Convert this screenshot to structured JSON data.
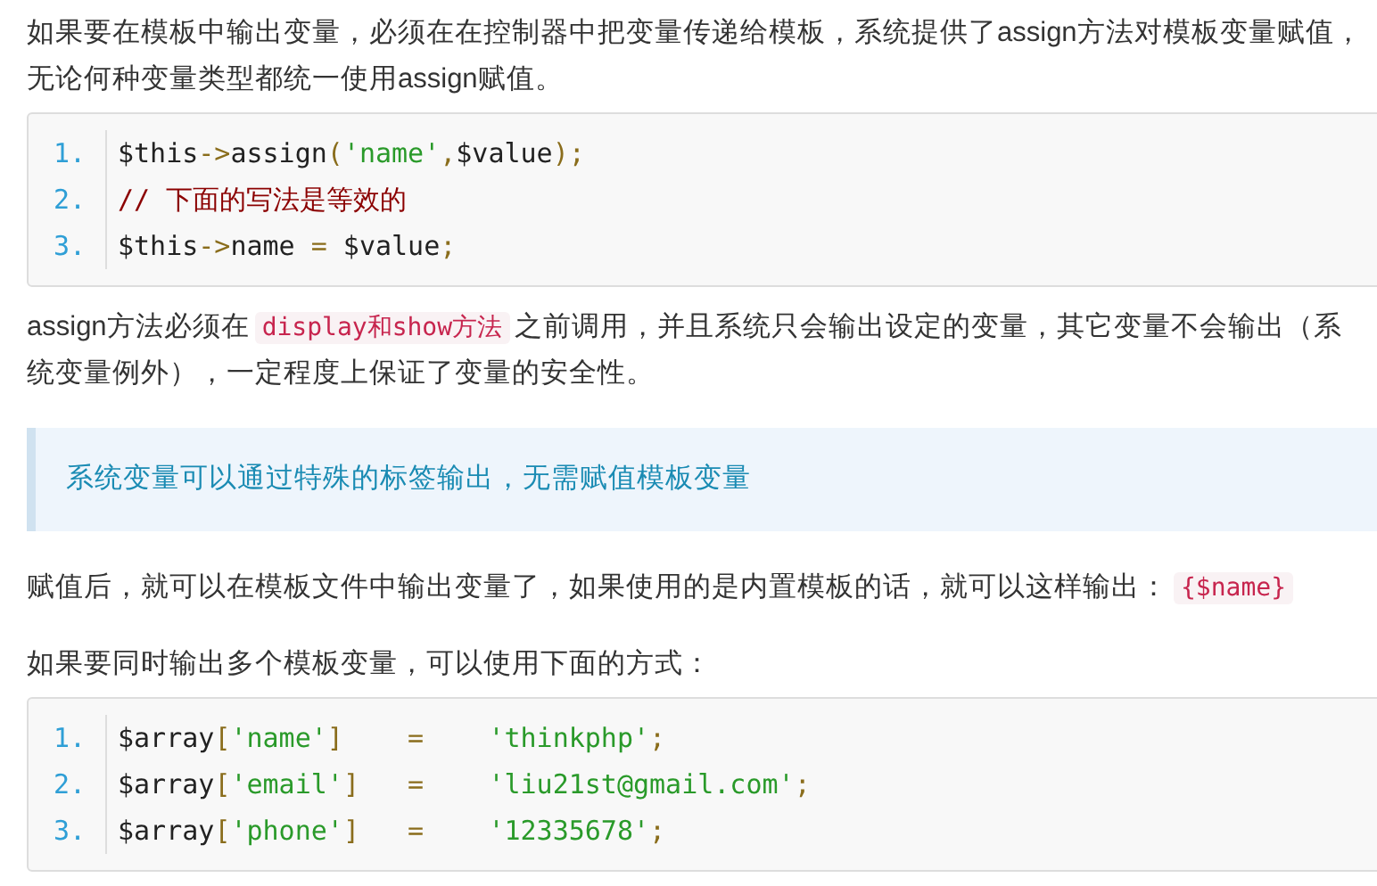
{
  "blocks": [
    {
      "kind": "paragraph",
      "parts": [
        {
          "kind": "text",
          "text": "如果要在模板中输出变量，必须在在控制器中把变量传递给模板，系统提供了assign方法对模板变量赋值，无论何种变量类型都统一使用assign赋值。"
        }
      ]
    },
    {
      "kind": "code",
      "lines": [
        {
          "number": "1.",
          "tokens": [
            {
              "kind": "plain",
              "text": "$this"
            },
            {
              "kind": "punct",
              "text": "->"
            },
            {
              "kind": "plain",
              "text": "assign"
            },
            {
              "kind": "punct",
              "text": "("
            },
            {
              "kind": "string",
              "text": "'name'"
            },
            {
              "kind": "punct",
              "text": ","
            },
            {
              "kind": "plain",
              "text": "$value"
            },
            {
              "kind": "punct",
              "text": ");"
            }
          ]
        },
        {
          "number": "2.",
          "tokens": [
            {
              "kind": "comment",
              "text": "// 下面的写法是等效的"
            }
          ]
        },
        {
          "number": "3.",
          "tokens": [
            {
              "kind": "plain",
              "text": "$this"
            },
            {
              "kind": "punct",
              "text": "->"
            },
            {
              "kind": "plain",
              "text": "name "
            },
            {
              "kind": "punct",
              "text": "="
            },
            {
              "kind": "plain",
              "text": " $value"
            },
            {
              "kind": "punct",
              "text": ";"
            }
          ]
        }
      ]
    },
    {
      "kind": "paragraph",
      "parts": [
        {
          "kind": "text",
          "text": "assign方法必须在"
        },
        {
          "kind": "code",
          "text": "display和show方法"
        },
        {
          "kind": "text",
          "text": "之前调用，并且系统只会输出设定的变量，其它变量不会输出（系统变量例外），一定程度上保证了变量的安全性。"
        }
      ]
    },
    {
      "kind": "note",
      "text": "系统变量可以通过特殊的标签输出，无需赋值模板变量"
    },
    {
      "kind": "paragraph",
      "parts": [
        {
          "kind": "text",
          "text": "赋值后，就可以在模板文件中输出变量了，如果使用的是内置模板的话，就可以这样输出："
        },
        {
          "kind": "code",
          "text": "{$name}"
        }
      ]
    },
    {
      "kind": "paragraph",
      "parts": [
        {
          "kind": "text",
          "text": "如果要同时输出多个模板变量，可以使用下面的方式："
        }
      ]
    },
    {
      "kind": "code",
      "lines": [
        {
          "number": "1.",
          "tokens": [
            {
              "kind": "plain",
              "text": "$array"
            },
            {
              "kind": "punct",
              "text": "["
            },
            {
              "kind": "string",
              "text": "'name'"
            },
            {
              "kind": "punct",
              "text": "]    =    "
            },
            {
              "kind": "string",
              "text": "'thinkphp'"
            },
            {
              "kind": "punct",
              "text": ";"
            }
          ]
        },
        {
          "number": "2.",
          "tokens": [
            {
              "kind": "plain",
              "text": "$array"
            },
            {
              "kind": "punct",
              "text": "["
            },
            {
              "kind": "string",
              "text": "'email'"
            },
            {
              "kind": "punct",
              "text": "]   =    "
            },
            {
              "kind": "string",
              "text": "'liu21st@gmail.com'"
            },
            {
              "kind": "punct",
              "text": ";"
            }
          ]
        },
        {
          "number": "3.",
          "tokens": [
            {
              "kind": "plain",
              "text": "$array"
            },
            {
              "kind": "punct",
              "text": "["
            },
            {
              "kind": "string",
              "text": "'phone'"
            },
            {
              "kind": "punct",
              "text": "]   =    "
            },
            {
              "kind": "string",
              "text": "'12335678'"
            },
            {
              "kind": "punct",
              "text": ";"
            }
          ]
        }
      ]
    }
  ]
}
